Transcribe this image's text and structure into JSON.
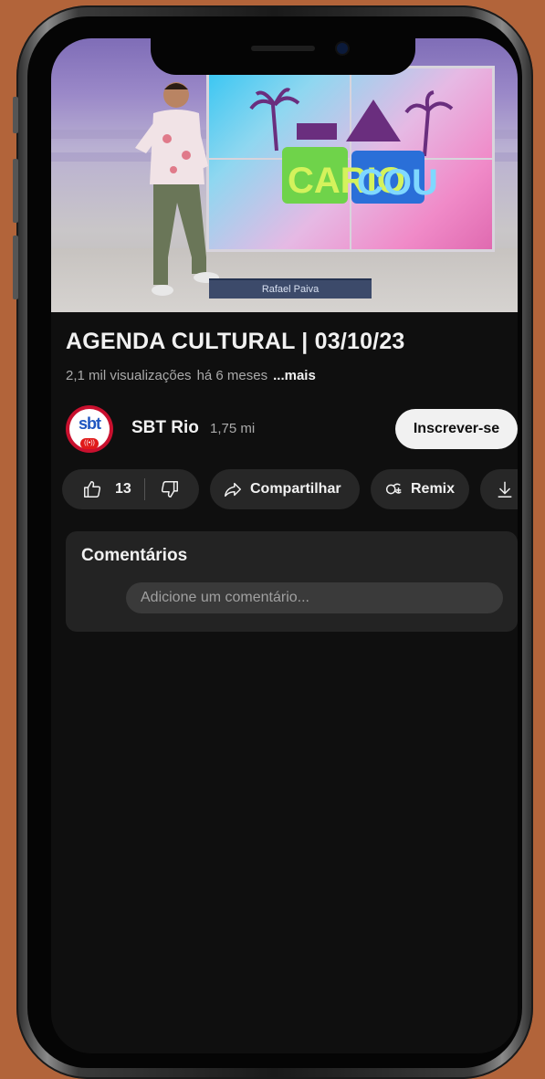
{
  "video": {
    "lower_third": "Rafael Paiva",
    "graphic_text": "CARIOCOU"
  },
  "title": "AGENDA CULTURAL | 03/10/23",
  "meta": {
    "views": "2,1 mil visualizações",
    "age": "há 6 meses",
    "more": "...mais"
  },
  "channel": {
    "avatar_text": "sbt",
    "name": "SBT Rio",
    "subscribers": "1,75 mi",
    "subscribe_label": "Inscrever-se"
  },
  "actions": {
    "likes": "13",
    "share_label": "Compartilhar",
    "remix_label": "Remix"
  },
  "comments": {
    "heading": "Comentários",
    "placeholder": "Adicione um comentário..."
  },
  "colors": {
    "background": "#b2643a",
    "screen": "#0f0f0f",
    "pill": "#272727",
    "text_primary": "#f1f1f1",
    "text_secondary": "#aaaaaa"
  }
}
